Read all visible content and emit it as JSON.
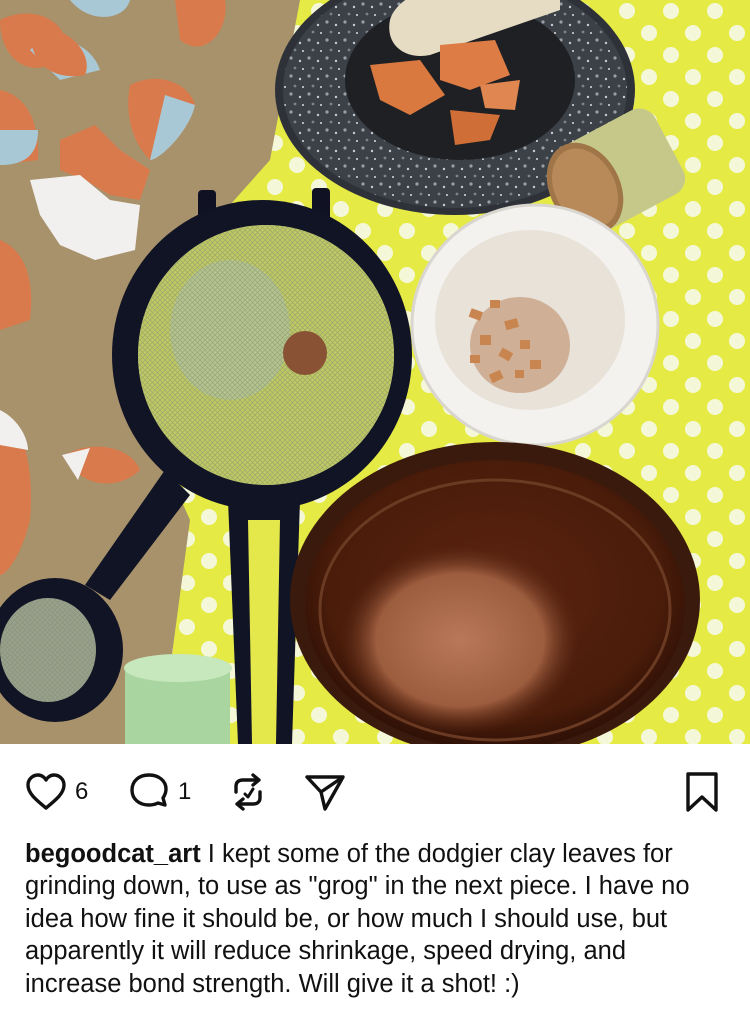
{
  "post": {
    "image": {
      "description_icon": "photo-mortar-pestle-sieves-clay-grog"
    },
    "actions": {
      "like_icon": "heart-icon",
      "like_count": "6",
      "comment_icon": "comment-icon",
      "comment_count": "1",
      "repost_icon": "repost-icon",
      "share_icon": "share-icon",
      "save_icon": "bookmark-icon"
    },
    "caption": {
      "username": "begoodcat_art",
      "text": "I kept some of the dodgier clay leaves for grinding down, to use as \"grog\" in the next piece. I have no idea how fine it should be, or how much I should use, but apparently it will reduce shrinkage, speed drying, and increase bond strength. Will give it a shot! :)"
    }
  }
}
